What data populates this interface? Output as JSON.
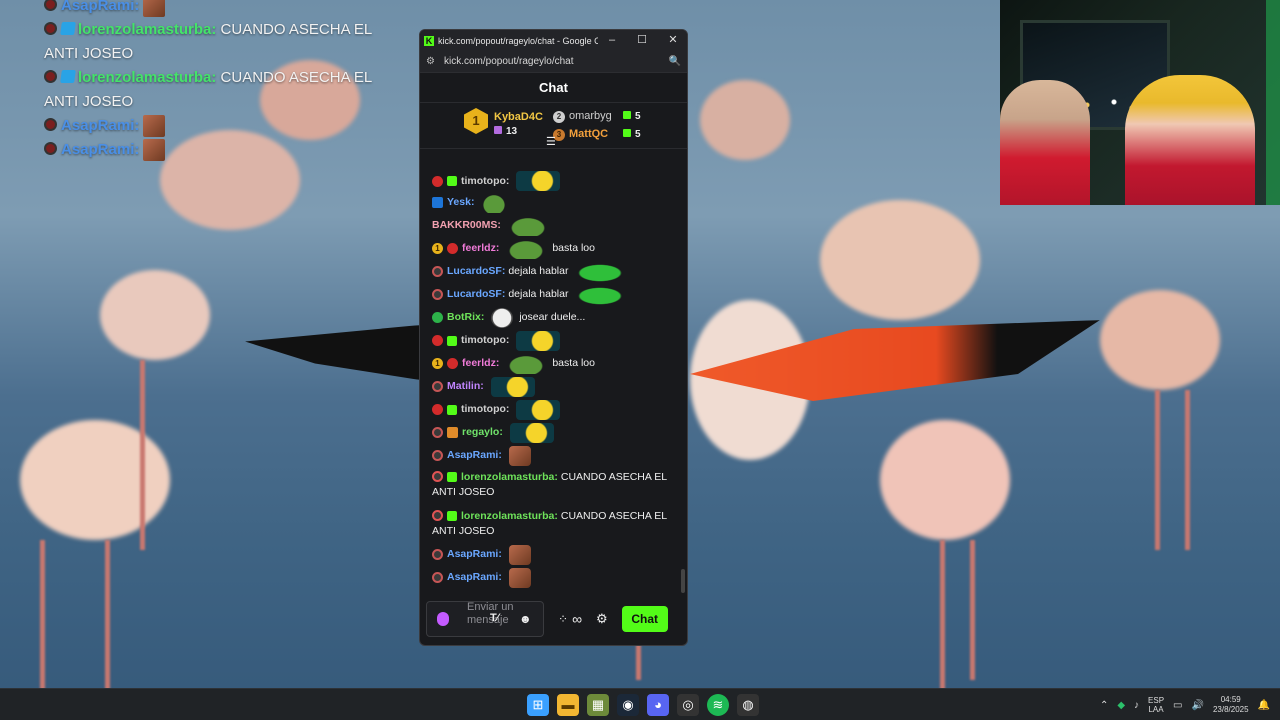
{
  "overlay_chat": [
    {
      "user": "AsapRami:",
      "text": "",
      "color": "blue",
      "emote": true
    },
    {
      "user": "lorenzolamasturba:",
      "text": "CUANDO ASECHA EL",
      "text2": "ANTI JOSEO",
      "color": "green"
    },
    {
      "user": "lorenzolamasturba:",
      "text": "CUANDO ASECHA EL",
      "text2": "ANTI JOSEO",
      "color": "green"
    },
    {
      "user": "AsapRami:",
      "text": "",
      "color": "blue",
      "emote": true
    },
    {
      "user": "AsapRami:",
      "text": "",
      "color": "blue",
      "emote": true
    }
  ],
  "browser": {
    "title": "kick.com/popout/rageylo/chat - Google Ch...",
    "address": "kick.com/popout/rageylo/chat",
    "minimize": "–",
    "maximize": "☐",
    "close": "✕"
  },
  "chat": {
    "header": "Chat",
    "leaders": {
      "first": {
        "rank": "1",
        "name": "KybaD4C",
        "count": "13"
      },
      "second": {
        "rank": "2",
        "name": "omarbyg",
        "count": "5"
      },
      "third": {
        "rank": "3",
        "name": "MattQC",
        "count": "5"
      }
    },
    "filter_icon": "☰",
    "messages": [
      {
        "user": "timotopo:",
        "text": ""
      },
      {
        "user": "Yesk:",
        "text": ""
      },
      {
        "user": "BAKKR00MS:",
        "text": ""
      },
      {
        "user": "feerldz:",
        "text": "basta loo"
      },
      {
        "user": "LucardoSF:",
        "text": "dejala hablar"
      },
      {
        "user": "LucardoSF:",
        "text": "dejala hablar"
      },
      {
        "user": "BotRix:",
        "text": "josear duele..."
      },
      {
        "user": "timotopo:",
        "text": ""
      },
      {
        "user": "feerldz:",
        "text": "basta loo"
      },
      {
        "user": "Matilin:",
        "text": ""
      },
      {
        "user": "timotopo:",
        "text": ""
      },
      {
        "user": "regaylo:",
        "text": ""
      },
      {
        "user": "AsapRami:",
        "text": ""
      },
      {
        "user": "lorenzolamasturba:",
        "text": "CUANDO ASECHA EL ANTI JOSEO"
      },
      {
        "user": "lorenzolamasturba:",
        "text": "CUANDO ASECHA EL ANTI JOSEO"
      },
      {
        "user": "AsapRami:",
        "text": ""
      },
      {
        "user": "AsapRami:",
        "text": ""
      }
    ],
    "input_placeholder": "Enviar un mensaje",
    "send_label": "Chat"
  },
  "taskbar": {
    "lang": "ESP",
    "lang2": "LAA",
    "time": "04:59",
    "date": "23/8/2025"
  },
  "colors": {
    "kick_green": "#53fc18",
    "chat_bg": "#18191c"
  }
}
